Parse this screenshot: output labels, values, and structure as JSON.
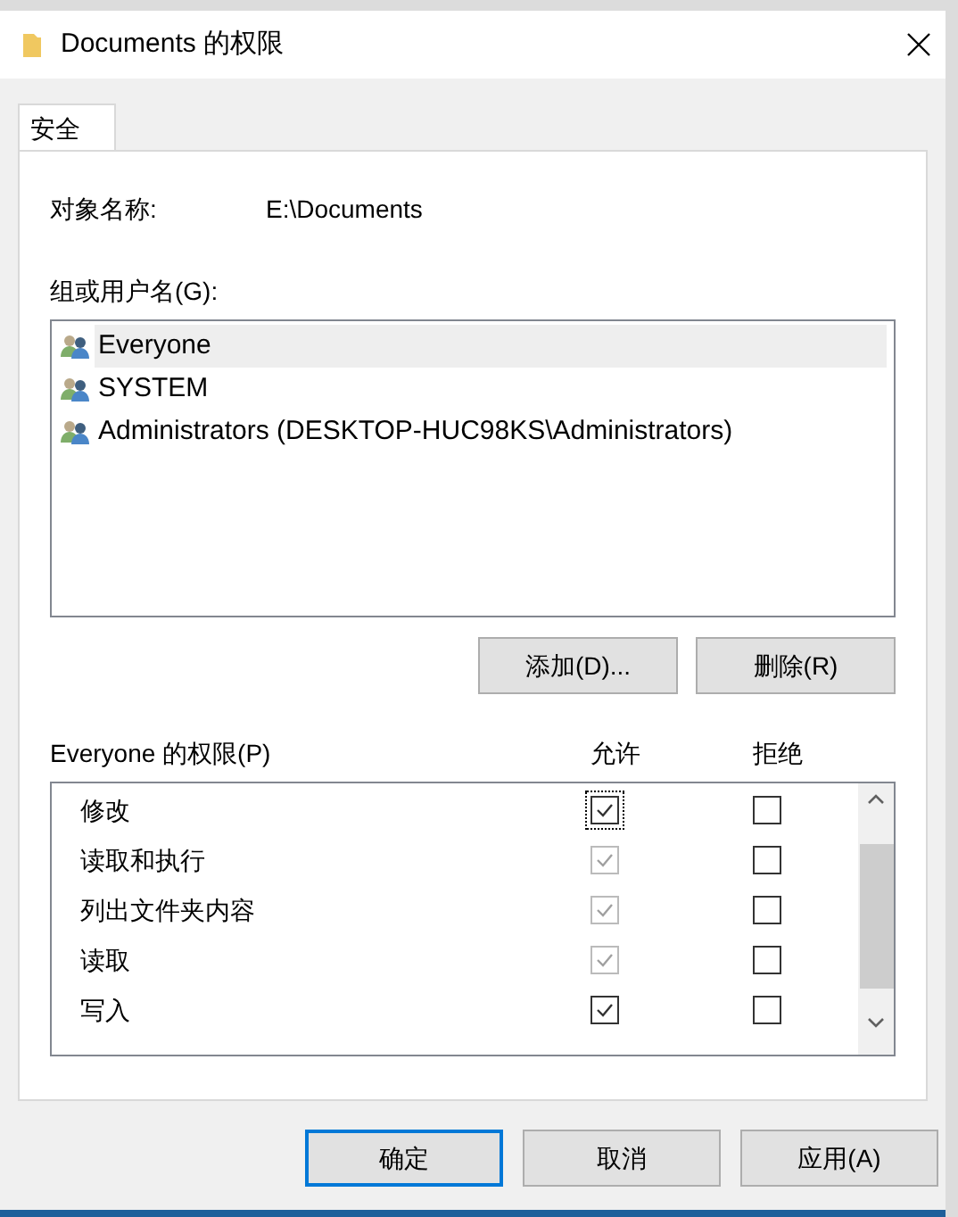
{
  "window": {
    "title": "Documents 的权限"
  },
  "tabs": [
    {
      "label": "安全",
      "selected": true
    }
  ],
  "object": {
    "label": "对象名称:",
    "value": "E:\\Documents"
  },
  "groups": {
    "label": "组或用户名(G):",
    "items": [
      {
        "name": "Everyone",
        "selected": true
      },
      {
        "name": "SYSTEM",
        "selected": false
      },
      {
        "name": "Administrators (DESKTOP-HUC98KS\\Administrators)",
        "selected": false
      }
    ]
  },
  "group_buttons": [
    "添加(D)...",
    "删除(R)"
  ],
  "permissions": {
    "label": "Everyone 的权限(P)",
    "allow_header": "允许",
    "deny_header": "拒绝",
    "items": [
      {
        "name": "修改",
        "allow": true,
        "allow_disabled": false,
        "focused": true,
        "deny": false
      },
      {
        "name": "读取和执行",
        "allow": true,
        "allow_disabled": true,
        "focused": false,
        "deny": false
      },
      {
        "name": "列出文件夹内容",
        "allow": true,
        "allow_disabled": true,
        "focused": false,
        "deny": false
      },
      {
        "name": "读取",
        "allow": true,
        "allow_disabled": true,
        "focused": false,
        "deny": false
      },
      {
        "name": "写入",
        "allow": true,
        "allow_disabled": false,
        "focused": false,
        "deny": false
      }
    ]
  },
  "dialog_buttons": [
    {
      "label": "确定",
      "default": true
    },
    {
      "label": "取消",
      "default": false
    },
    {
      "label": "应用(A)",
      "default": false
    }
  ]
}
